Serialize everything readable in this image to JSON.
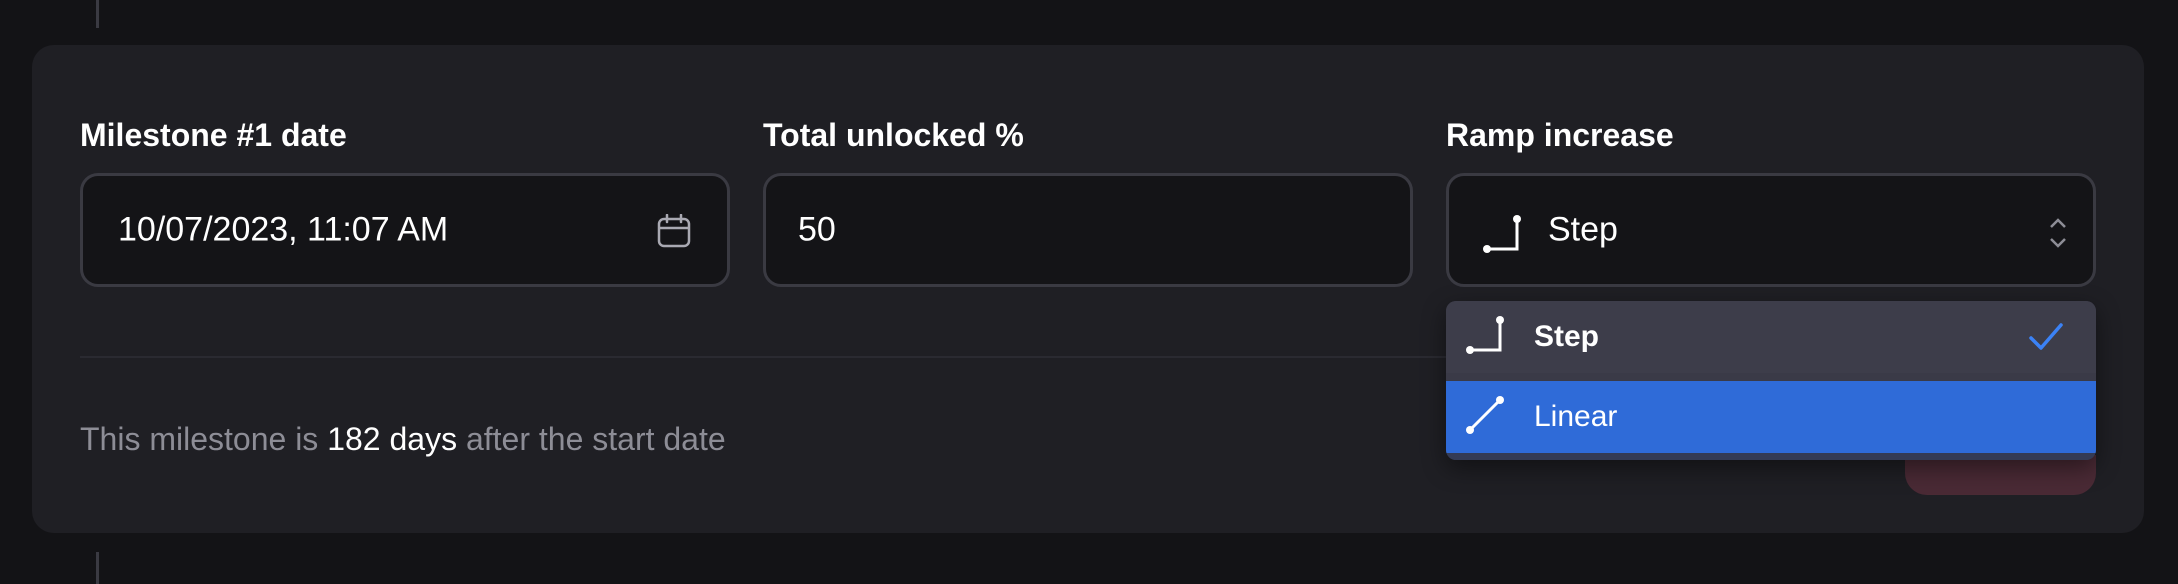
{
  "milestone_date": {
    "label": "Milestone #1 date",
    "value": "10/07/2023, 11:07 AM",
    "icon": "calendar-icon"
  },
  "total_unlocked": {
    "label": "Total unlocked %",
    "value": "50"
  },
  "ramp_increase": {
    "label": "Ramp increase",
    "selected": "Step",
    "selected_icon": "step-ramp-icon",
    "options": [
      {
        "label": "Step",
        "icon": "step-ramp-icon",
        "checked": true
      },
      {
        "label": "Linear",
        "icon": "linear-ramp-icon",
        "highlighted": true
      }
    ]
  },
  "summary": {
    "prefix": "This milestone is ",
    "days": "182 days",
    "suffix": " after the start date"
  },
  "colors": {
    "background": "#131316",
    "card": "#1f1f24",
    "input": "#141417",
    "highlight": "#2f6bd8",
    "check": "#3b82f6"
  }
}
